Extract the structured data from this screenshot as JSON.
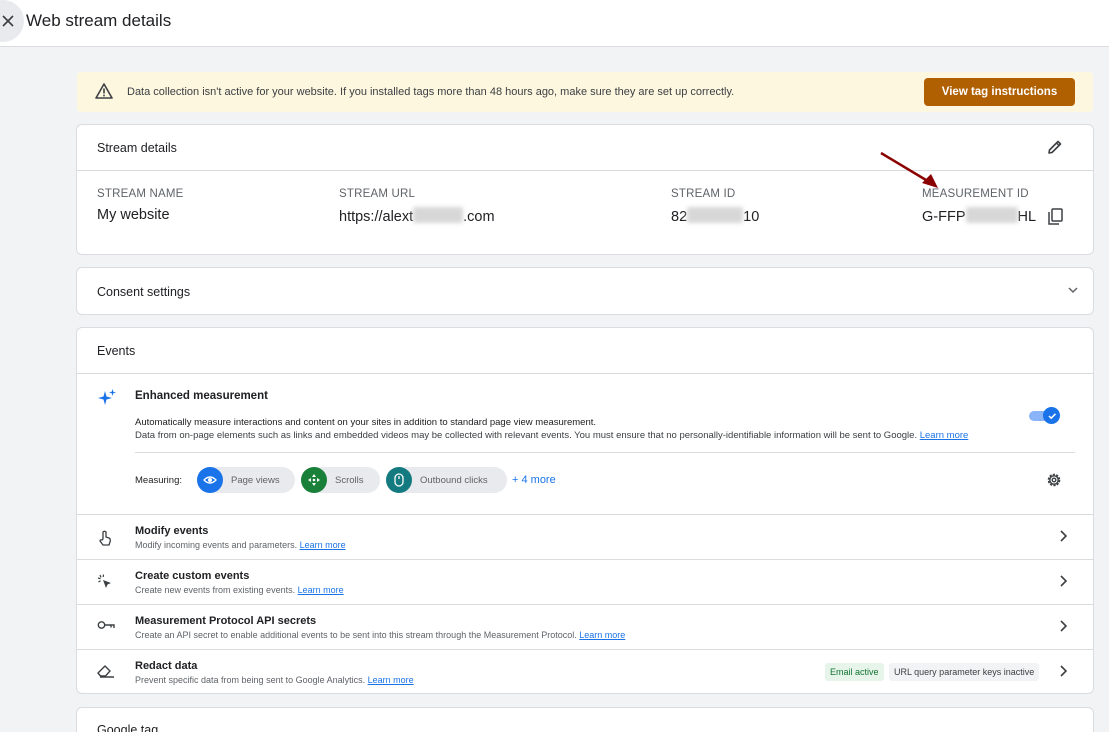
{
  "header": {
    "title": "Web stream details"
  },
  "banner": {
    "message": "Data collection isn't active for your website. If you installed tags more than 48 hours ago, make sure they are set up correctly.",
    "button_label": "View tag instructions"
  },
  "stream_details": {
    "title": "Stream details",
    "name_label": "STREAM NAME",
    "name_value": "My website",
    "url_label": "STREAM URL",
    "url_prefix": "https://alext",
    "url_suffix": ".com",
    "id_label": "STREAM ID",
    "id_prefix": "82",
    "id_suffix": "10",
    "measurement_label": "MEASUREMENT ID",
    "measurement_prefix": "G-FFP",
    "measurement_suffix": "HL"
  },
  "consent": {
    "title": "Consent settings"
  },
  "events": {
    "title": "Events",
    "enhanced": {
      "title": "Enhanced measurement",
      "desc1": "Automatically measure interactions and content on your sites in addition to standard page view measurement.",
      "desc2": "Data from on-page elements such as links and embedded videos may be collected with relevant events. You must ensure that no personally-identifiable information will be sent to Google.",
      "learn_more": "Learn more",
      "enabled": true,
      "measuring_label": "Measuring:",
      "chips": [
        "Page views",
        "Scrolls",
        "Outbound clicks"
      ],
      "more": "+ 4 more"
    },
    "rows": [
      {
        "title": "Modify events",
        "desc": "Modify incoming events and parameters.",
        "link": "Learn more"
      },
      {
        "title": "Create custom events",
        "desc": "Create new events from existing events.",
        "link": "Learn more"
      },
      {
        "title": "Measurement Protocol API secrets",
        "desc": "Create an API secret to enable additional events to be sent into this stream through the Measurement Protocol.",
        "link": "Learn more"
      },
      {
        "title": "Redact data",
        "desc": "Prevent specific data from being sent to Google Analytics.",
        "link": "Learn more",
        "tags": [
          "Email active",
          "URL query parameter keys inactive"
        ]
      }
    ]
  },
  "google_tag": {
    "title": "Google tag"
  },
  "colors": {
    "accent": "#1a73e8",
    "warning_button": "#b06000",
    "banner_bg": "#fef7e0",
    "annotation_arrow": "#8b0000"
  }
}
